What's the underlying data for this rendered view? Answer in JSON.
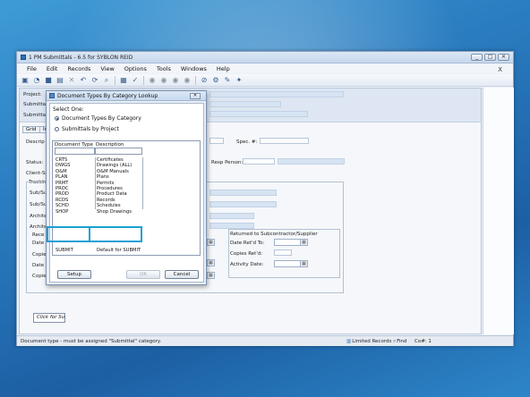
{
  "window": {
    "title": "1 PM Submittals - 6.5 for SYBLON REID",
    "controls": [
      "_",
      "□",
      "✕"
    ],
    "mdi_close": "X"
  },
  "menu": [
    "File",
    "Edit",
    "Records",
    "View",
    "Options",
    "Tools",
    "Windows",
    "Help"
  ],
  "toolbar_icons": [
    "new-icon",
    "open-icon",
    "save-icon",
    "print-icon",
    "delete-icon",
    "undo-icon",
    "refresh-icon",
    "search-icon",
    "attach-icon",
    "spellcheck-icon",
    "first-icon",
    "prev-icon",
    "next-icon",
    "last-icon",
    "link-icon",
    "tools-icon",
    "edit-icon",
    "settings-icon"
  ],
  "child": {
    "project_label": "Project:",
    "submittal1_label": "Submittal",
    "submittal2_label": "Submittal",
    "tab_grid": "Grid",
    "tab_in": "In",
    "descr_label": "Descrip",
    "spec_label": "Spec. #:",
    "status_label": "Status:",
    "resp_label": "Resp Person:",
    "client_label": "Client-Sp",
    "tracking_label": "Tracking",
    "subsup1_label": "Sub/Su",
    "subsup2_label": "Sub/Su",
    "archit1_label": "Archite",
    "archit2_label": "Archite",
    "rece_label": "Rece",
    "date1_label": "Date",
    "copies_label": "Copies",
    "date2_label": "Date R",
    "copie2_label": "Copie",
    "returned_title": "Returned to Subcontractor/Supplier",
    "date_retd_label": "Date Ret'd To:",
    "copies_retd_label": "Copies Ret'd:",
    "activity_date_label": "Activity Date:",
    "click_for_label": "Click for Su"
  },
  "statusbar": {
    "message": "Document type - must be assigned \"Submittal\" category.",
    "limited": "Limited Records",
    "find": "Find",
    "co": "Co#: 1"
  },
  "dialog": {
    "title": "Document Types By Category Lookup",
    "close": "✕",
    "select_one": "Select One:",
    "radio_category": "Document Types By Category",
    "radio_project": "Submittals by Project",
    "col_doc_type": "Document Type",
    "col_description": "Description",
    "rows": [
      {
        "type": "CRTS",
        "desc": "Certificates"
      },
      {
        "type": "DWGS",
        "desc": "Drawings (ALL)"
      },
      {
        "type": "O&M",
        "desc": "O&M Manuals"
      },
      {
        "type": "PLAN",
        "desc": "Plans"
      },
      {
        "type": "PRMT",
        "desc": "Permits"
      },
      {
        "type": "PROC",
        "desc": "Procedures"
      },
      {
        "type": "PROD",
        "desc": "Product Data"
      },
      {
        "type": "RCDS",
        "desc": "Records"
      },
      {
        "type": "SCHD",
        "desc": "Schedules"
      },
      {
        "type": "SHOP",
        "desc": "Shop Drawings"
      }
    ],
    "highlight_row": {
      "type": "SUBMIT",
      "desc": "Default for SUBMIT"
    },
    "btn_setup": "Setup",
    "btn_ok": "OK",
    "btn_cancel": "Cancel"
  },
  "colors": {
    "callout": "#1aa0d6",
    "field_fill": "#d6e3f3"
  }
}
